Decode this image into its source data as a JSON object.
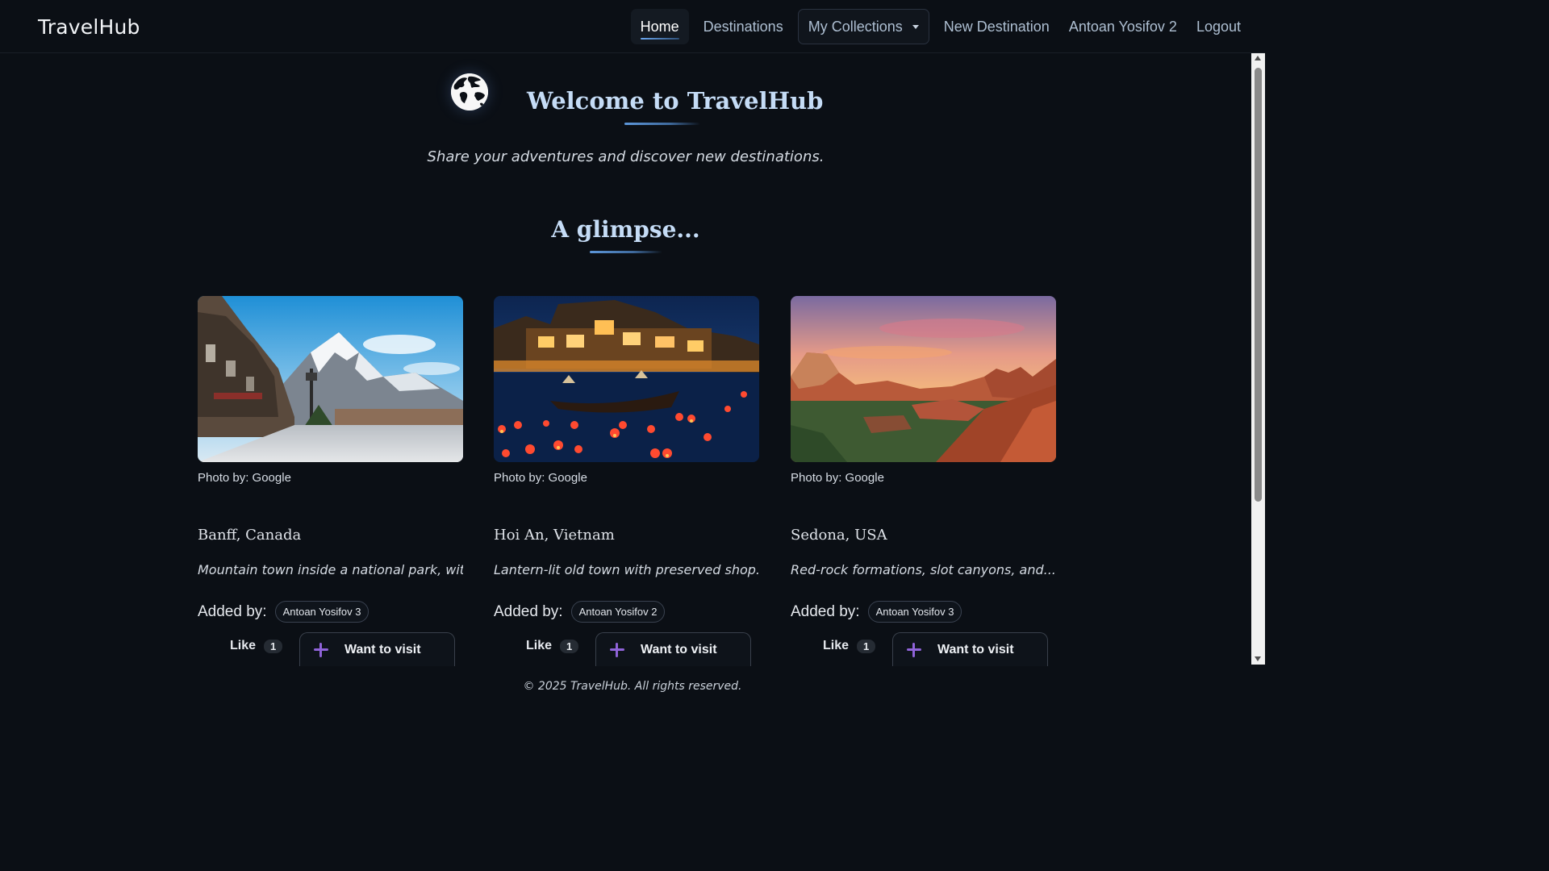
{
  "navbar": {
    "brand": "TravelHub",
    "items": [
      {
        "label": "Home"
      },
      {
        "label": "Destinations"
      },
      {
        "label": "My Collections"
      },
      {
        "label": "New Destination"
      },
      {
        "label": "Antoan Yosifov 2"
      },
      {
        "label": "Logout"
      }
    ]
  },
  "hero": {
    "title": "Welcome to TravelHub",
    "subtitle": "Share your adventures and discover new destinations.",
    "icon": "globe-icon"
  },
  "glimpse": {
    "title": "A glimpse...",
    "cards": [
      {
        "photo_credit": "Photo by: Google",
        "place": "Banff, Canada",
        "description": "Mountain town inside a national park, with...",
        "added_by_label": "Added by:",
        "added_by": "Antoan Yosifov 3",
        "like_label": "Like",
        "like_count": "1",
        "want_label": "Want to visit"
      },
      {
        "photo_credit": "Photo by: Google",
        "place": "Hoi An, Vietnam",
        "description": "Lantern-lit old town with preserved shop...",
        "added_by_label": "Added by:",
        "added_by": "Antoan Yosifov 2",
        "like_label": "Like",
        "like_count": "1",
        "want_label": "Want to visit"
      },
      {
        "photo_credit": "Photo by: Google",
        "place": "Sedona, USA",
        "description": "Red-rock formations, slot canyons, and...",
        "added_by_label": "Added by:",
        "added_by": "Antoan Yosifov 3",
        "like_label": "Like",
        "like_count": "1",
        "want_label": "Want to visit"
      }
    ]
  },
  "footer": {
    "text": "© 2025 TravelHub. All rights reserved."
  },
  "colors": {
    "background": "#0b0f15",
    "heading": "#c5dcf6",
    "accent_underline": "#5d97da",
    "plus_icon": "#8f63d8"
  }
}
